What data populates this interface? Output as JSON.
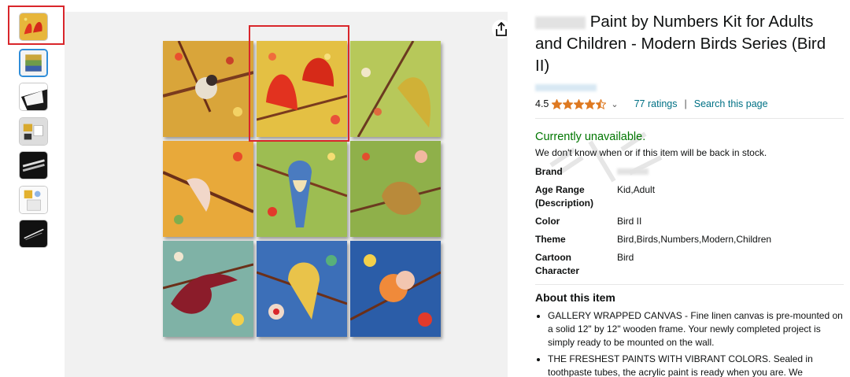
{
  "product": {
    "title": "Paint by Numbers Kit for Adults and Children - Modern Birds Series (Bird II)",
    "share_icon": "share-icon"
  },
  "rating": {
    "value": "4.5",
    "stars_fraction": 0.9,
    "ratings_count": "77 ratings",
    "search_link": "Search this page",
    "separator": "|"
  },
  "availability": {
    "status": "Currently unavailable.",
    "note": "We don't know when or if this item will be back in stock."
  },
  "specs": [
    {
      "label": "Brand",
      "value": ""
    },
    {
      "label": "Age Range (Description)",
      "value": "Kid,Adult"
    },
    {
      "label": "Color",
      "value": "Bird II"
    },
    {
      "label": "Theme",
      "value": "Bird,Birds,Numbers,Modern,Children"
    },
    {
      "label": "Cartoon Character",
      "value": "Bird"
    }
  ],
  "about": {
    "heading": "About this item",
    "bullets": [
      "GALLERY WRAPPED CANVAS - Fine linen canvas is pre-mounted on a solid 12\" by 12\" wooden frame. Your newly completed project is simply ready to be mounted on the wall.",
      "THE FRESHEST PAINTS WITH VIBRANT COLORS. Sealed in toothpaste tubes, the acrylic paint is ready when you are. We"
    ]
  },
  "colors": {
    "link": "#007185",
    "available_green": "#007600",
    "star": "#de7921",
    "highlight_red": "#d9262b"
  }
}
